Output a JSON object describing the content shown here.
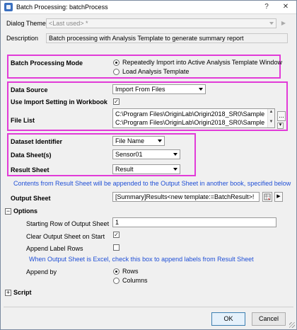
{
  "window": {
    "title": "Batch Processing: batchProcess",
    "help_glyph": "?",
    "close_glyph": "✕"
  },
  "dialog_theme": {
    "label": "Dialog Theme",
    "value": "<Last used> *"
  },
  "description": {
    "label": "Description",
    "value": "Batch processing with Analysis Template to generate summary report"
  },
  "mode": {
    "label": "Batch Processing Mode",
    "options": [
      "Repeatedly Import into Active Analysis Template Window",
      "Load Analysis Template"
    ],
    "selected": 0
  },
  "data_source": {
    "label": "Data Source",
    "value": "Import From Files"
  },
  "use_import_setting": {
    "label": "Use Import Setting in Workbook",
    "checked": true
  },
  "file_list": {
    "label": "File List",
    "items": [
      "C:\\Program Files\\OriginLab\\Origin2018_SR0\\Sample",
      "C:\\Program Files\\OriginLab\\Origin2018_SR0\\Sample"
    ],
    "browse_label": "..."
  },
  "dataset_identifier": {
    "label": "Dataset Identifier",
    "value": "File Name"
  },
  "data_sheets": {
    "label": "Data Sheet(s)",
    "value": "Sensor01"
  },
  "result_sheet": {
    "label": "Result Sheet",
    "value": "Result"
  },
  "info_result": "Contents from Result Sheet will be appended to the Output Sheet in another book, specified below",
  "output_sheet": {
    "label": "Output Sheet",
    "value": "[Summary]Results<new template:=BatchResult>!"
  },
  "options": {
    "label": "Options",
    "toggle": "−",
    "starting_row": {
      "label": "Starting Row of Output Sheet",
      "value": "1"
    },
    "clear_output": {
      "label": "Clear Output Sheet on Start",
      "checked": true
    },
    "append_label_rows": {
      "label": "Append Label Rows",
      "checked": false
    },
    "info_excel": "When Output Sheet is Excel, check this box to append labels from Result Sheet",
    "append_by": {
      "label": "Append by",
      "options": [
        "Rows",
        "Columns"
      ],
      "selected": 0
    }
  },
  "script": {
    "label": "Script",
    "toggle": "+"
  },
  "buttons": {
    "ok": "OK",
    "cancel": "Cancel"
  },
  "colors": {
    "highlight": "#e23bd8",
    "info_text": "#1f4fd6"
  }
}
